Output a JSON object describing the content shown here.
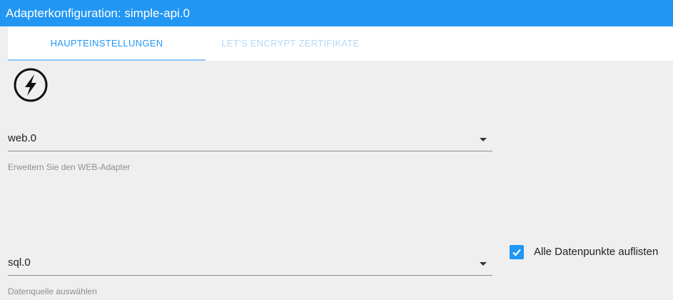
{
  "window": {
    "title": "Adapterkonfiguration: simple-api.0"
  },
  "tabs": [
    {
      "label": "HAUPTEINSTELLUNGEN",
      "active": true
    },
    {
      "label": "LET'S ENCRYPT ZERTIFIKATE",
      "active": false
    }
  ],
  "logo": {
    "icon": "socketio-lightning-icon"
  },
  "web_select": {
    "value": "web.0",
    "helper": "Erweitern Sie den WEB-Adapter"
  },
  "data_source_select": {
    "value": "sql.0",
    "helper": "Datenquelle auswählen"
  },
  "list_all_checkbox": {
    "label": "Alle Datenpunkte auflisten",
    "checked": true
  },
  "colors": {
    "accent": "#2196f3",
    "background": "#efefef",
    "inactive_tab": "#b3d8f7"
  }
}
